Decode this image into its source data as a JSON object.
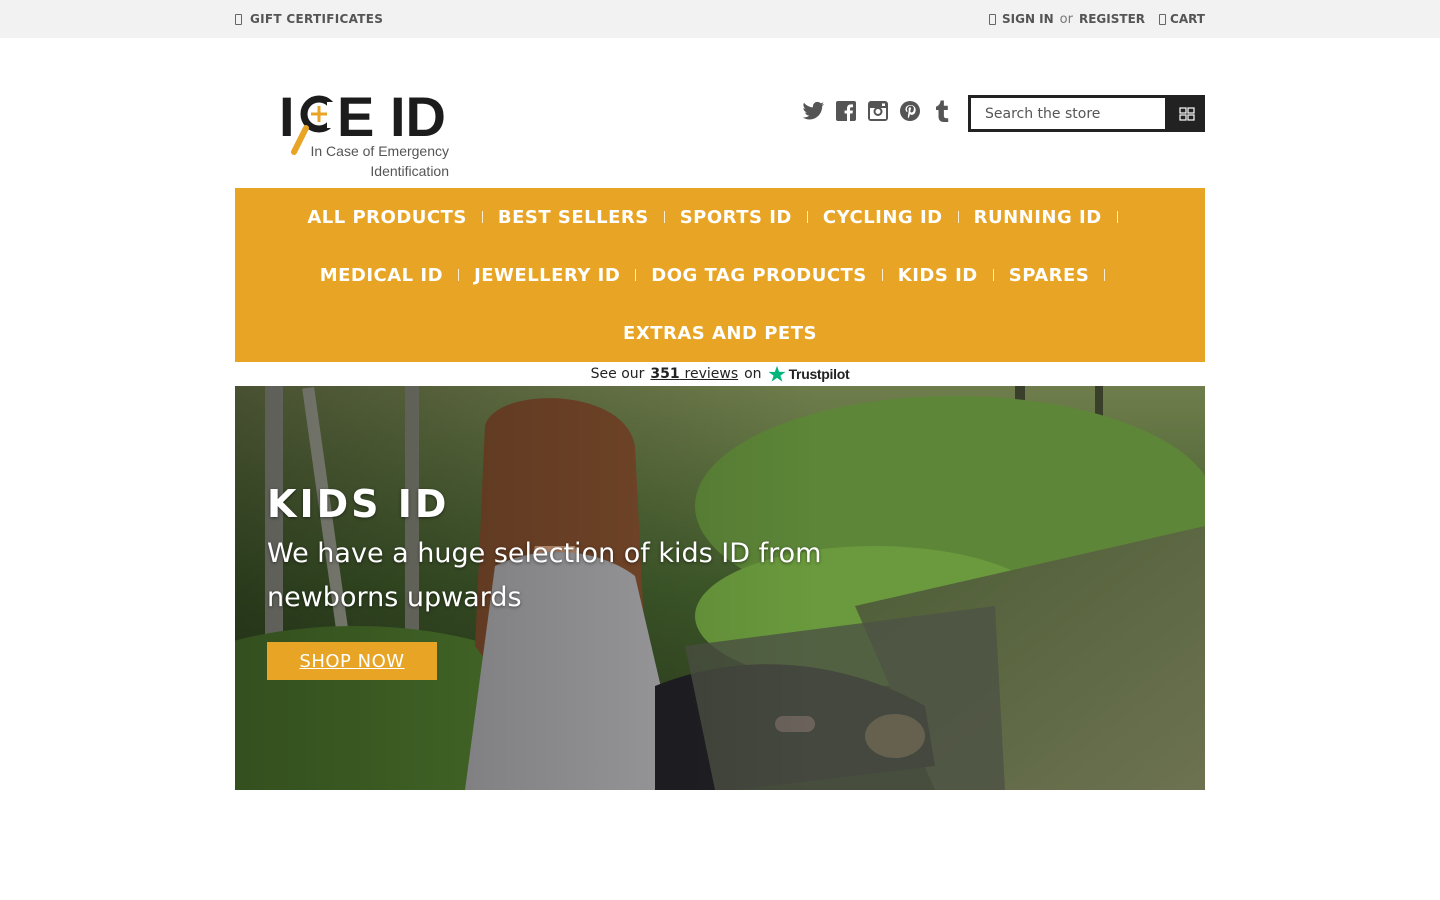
{
  "topbar": {
    "gift_label": "GIFT CERTIFICATES",
    "sign_in": "SIGN IN",
    "or": "or",
    "register": "REGISTER",
    "cart": "CART"
  },
  "logo": {
    "brand": "ICE ID",
    "tagline_1": "In Case of Emergency",
    "tagline_2": "Identification"
  },
  "social": [
    "twitter-icon",
    "facebook-icon",
    "instagram-icon",
    "pinterest-icon",
    "tumblr-icon"
  ],
  "search": {
    "placeholder": "Search the store"
  },
  "nav": {
    "row1": [
      "ALL PRODUCTS",
      "BEST SELLERS",
      "SPORTS ID",
      "CYCLING ID",
      "RUNNING ID"
    ],
    "row2": [
      "MEDICAL ID",
      "JEWELLERY ID",
      "DOG TAG PRODUCTS",
      "KIDS ID",
      "SPARES"
    ],
    "row3": [
      "EXTRAS AND PETS"
    ]
  },
  "trustpilot": {
    "prefix": "See our",
    "count": "351",
    "reviews": "reviews",
    "on": "on",
    "brand": "Trustpilot"
  },
  "hero": {
    "title": "KIDS ID",
    "subtitle": "We have a huge selection of kids ID from newborns upwards",
    "button": "SHOP NOW"
  },
  "colors": {
    "accent": "#e8a424",
    "dark": "#222222",
    "trust_green": "#00b67a"
  }
}
